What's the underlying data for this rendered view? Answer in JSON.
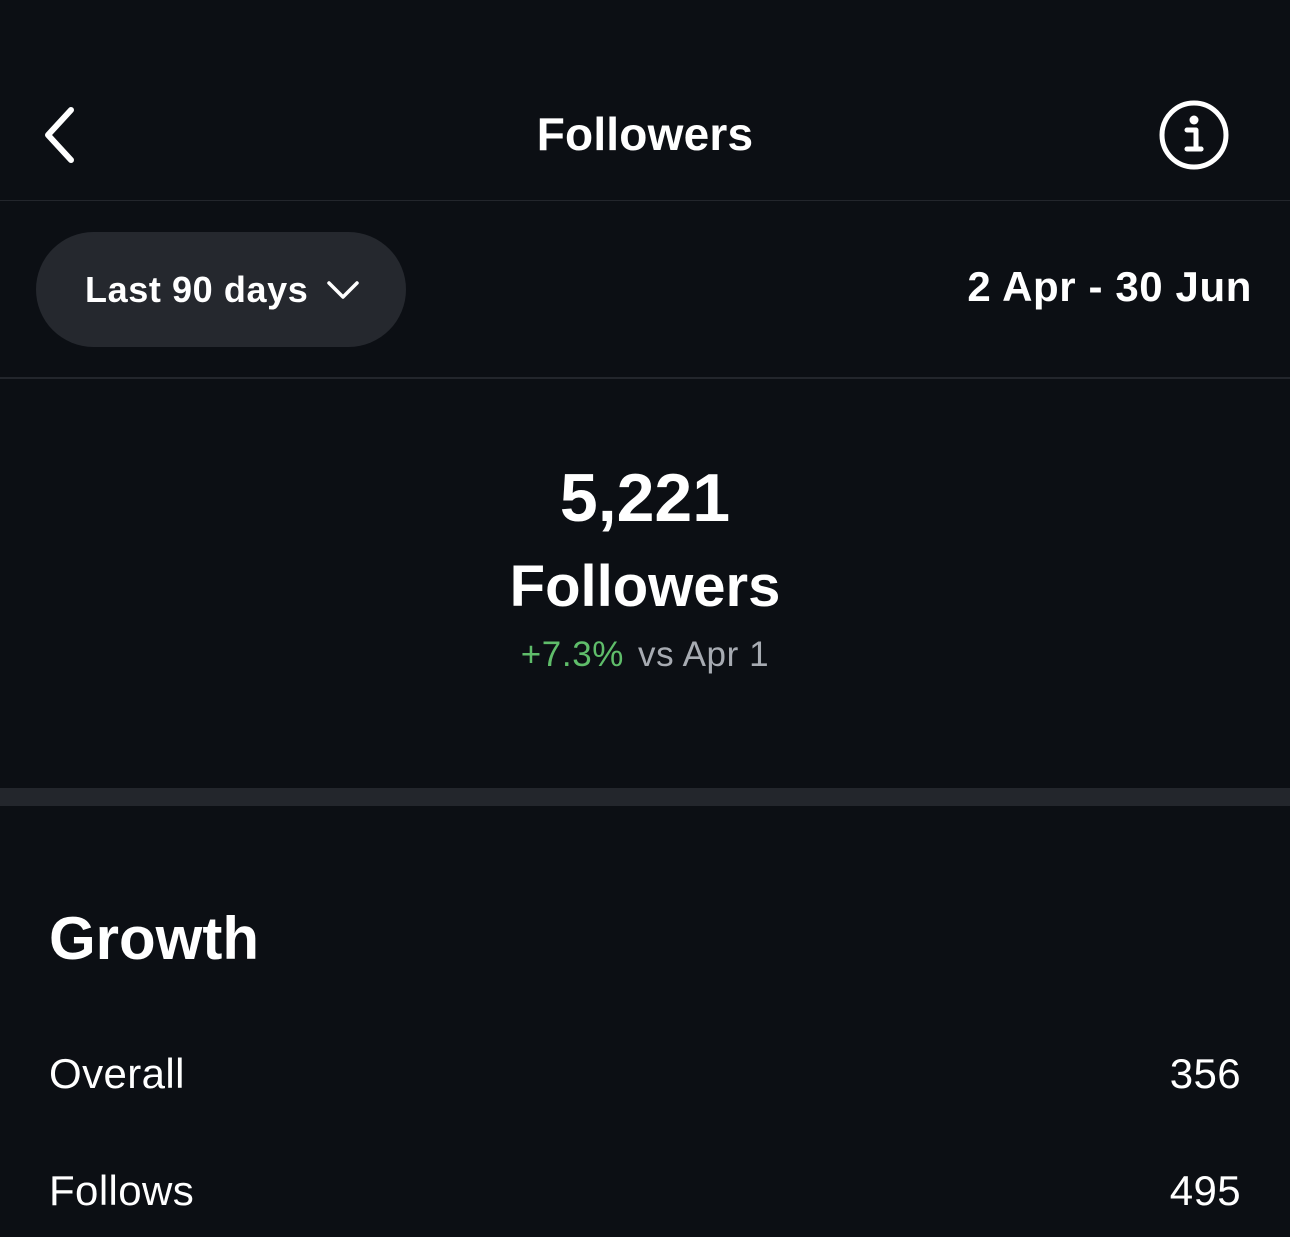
{
  "header": {
    "title": "Followers",
    "back_icon": "chevron-left-icon",
    "info_icon": "info-circle-icon"
  },
  "filter": {
    "range_label": "Last 90 days",
    "dropdown_icon": "chevron-down-icon",
    "date_range": "2 Apr - 30 Jun"
  },
  "summary": {
    "count": "5,221",
    "label": "Followers",
    "change_pct": "+7.3%",
    "change_compare": "vs Apr 1"
  },
  "growth": {
    "title": "Growth",
    "rows": [
      {
        "label": "Overall",
        "value": "356"
      },
      {
        "label": "Follows",
        "value": "495"
      }
    ]
  },
  "colors": {
    "background": "#0c0f14",
    "pill": "#25282e",
    "divider": "#23262c",
    "positive": "#5fbd6a",
    "muted": "#a7abb2"
  }
}
